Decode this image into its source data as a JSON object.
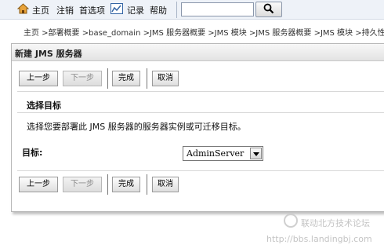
{
  "toolbar": {
    "home": "主页",
    "logout": "注销",
    "preferences": "首选项",
    "record": "记录",
    "help": "帮助",
    "search": {
      "value": "",
      "placeholder": ""
    }
  },
  "breadcrumb": "主页 >部署概要 >base_domain >JMS 服务器概要 >JMS 模块 >JMS 服务器概要 >JMS 模块 >持久性存储",
  "panel": {
    "title": "新建 JMS 服务器",
    "buttons": {
      "back": "上一步",
      "next": "下一步",
      "finish": "完成",
      "cancel": "取消"
    },
    "section_title": "选择目标",
    "description": "选择您要部署此 JMS 服务器的服务器实例或可迁移目标。",
    "target_label": "目标:",
    "target_value": "AdminServer"
  },
  "watermark": {
    "line1": "联动北方技术论坛",
    "line2": "http://bbs.landingbj.com"
  },
  "colors": {
    "toolbar_bg": "#eef2f8",
    "home_icon": "#e8a33a",
    "chart_icon": "#3465a4"
  }
}
